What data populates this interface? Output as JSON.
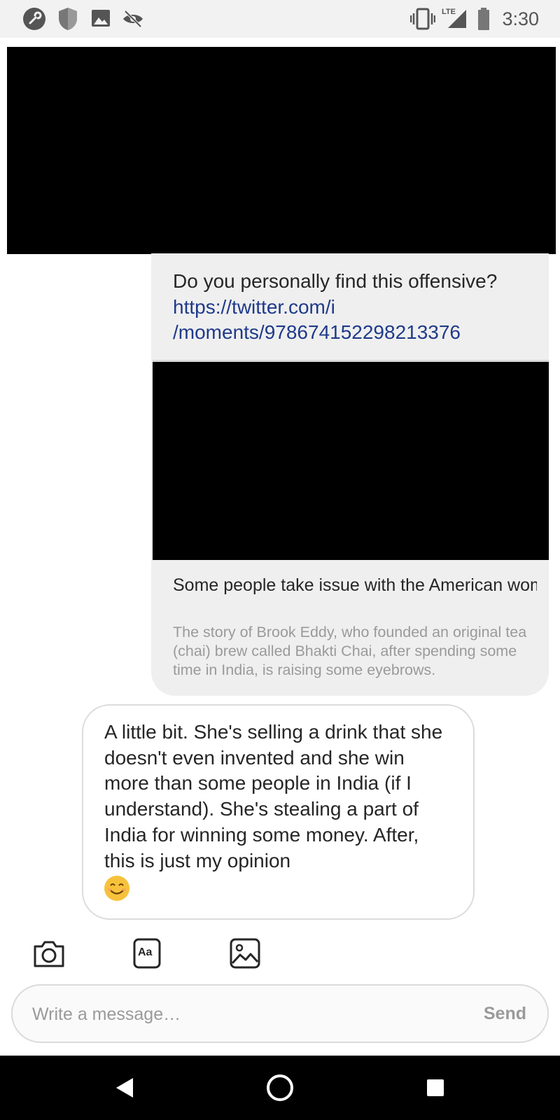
{
  "status_bar": {
    "time": "3:30",
    "network_label": "LTE",
    "icons": [
      "key-icon",
      "shield-icon",
      "image-icon",
      "eye-off-icon",
      "vibrate-icon",
      "signal-icon",
      "battery-icon"
    ]
  },
  "messages": {
    "received": {
      "text_prefix": "Do you personally find this offensive? ",
      "link": "https://twitter.com/i/moments/978674152298213376",
      "link_line1": "https://twitter.com/i",
      "link_line2": "/moments/978674152298213376",
      "preview_title": "Some people take issue with the American woman making millions sellin…",
      "preview_description": "The story of Brook Eddy, who founded an original tea (chai) brew called Bhakti Chai, after spending some time in India, is raising some eyebrows."
    },
    "sent": {
      "text": "A little bit. She's selling a drink that she doesn't even invented and she win more than some people in India (if I understand). She's stealing a part of India for winning some money. After, this is just my opinion",
      "emoji": "smiling-face-emoji"
    }
  },
  "toolbar": {
    "camera": "camera-icon",
    "text_style": "Aa",
    "gallery": "gallery-icon"
  },
  "composer": {
    "placeholder": "Write a message…",
    "send_label": "Send"
  },
  "nav": {
    "back": "back-icon",
    "home": "home-icon",
    "recents": "recents-icon"
  },
  "colors": {
    "link": "#1f3a8a",
    "bubble_in": "#efefef",
    "bubble_out_border": "#dcdcdc"
  }
}
